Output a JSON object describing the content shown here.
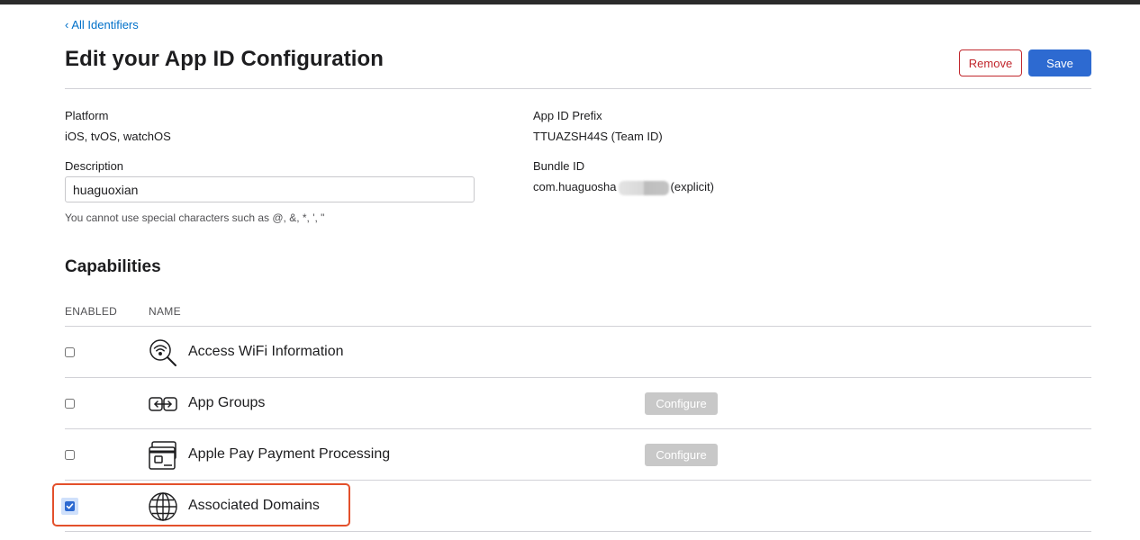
{
  "nav": {
    "back_label": "All Identifiers"
  },
  "header": {
    "title": "Edit your App ID Configuration",
    "remove_label": "Remove",
    "save_label": "Save"
  },
  "details": {
    "platform_label": "Platform",
    "platform_value": "iOS, tvOS, watchOS",
    "prefix_label": "App ID Prefix",
    "prefix_value": "TTUAZSH44S (Team ID)",
    "description_label": "Description",
    "description_value": "huaguoxian",
    "description_hint": "You cannot use special characters such as @, &, *, ', \"",
    "bundle_label": "Bundle ID",
    "bundle_value_prefix": "com.huaguosha",
    "bundle_value_suffix": "(explicit)"
  },
  "capabilities": {
    "title": "Capabilities",
    "col_enabled": "ENABLED",
    "col_name": "NAME",
    "items": [
      {
        "name": "Access WiFi Information",
        "enabled": false,
        "icon": "wifi-search-icon",
        "configure": null
      },
      {
        "name": "App Groups",
        "enabled": false,
        "icon": "app-groups-icon",
        "configure": "Configure"
      },
      {
        "name": "Apple Pay Payment Processing",
        "enabled": false,
        "icon": "payment-card-icon",
        "configure": "Configure"
      },
      {
        "name": "Associated Domains",
        "enabled": true,
        "icon": "globe-icon",
        "configure": null
      }
    ]
  },
  "colors": {
    "accent": "#2d6ad1",
    "link": "#0070c9",
    "danger": "#c1272d",
    "highlight_border": "#e3502b",
    "disabled_button": "#c8c8c8"
  }
}
